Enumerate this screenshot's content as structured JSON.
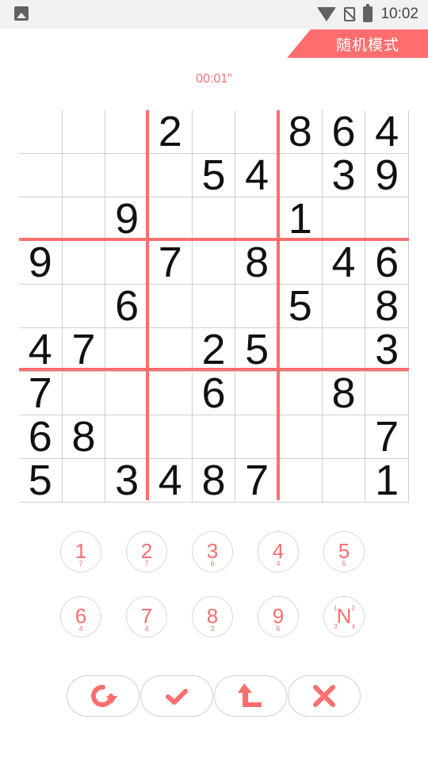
{
  "status_bar": {
    "time": "10:02",
    "icons": [
      "image-icon",
      "wifi-icon",
      "no-sim-icon",
      "battery-charging-icon"
    ]
  },
  "mode_label": "随机模式",
  "timer": "00:01\"",
  "accent_color": "#ff6e6e",
  "board": [
    [
      "",
      "",
      "",
      "2",
      "",
      "",
      "8",
      "6",
      "4"
    ],
    [
      "",
      "",
      "",
      "",
      "5",
      "4",
      "",
      "3",
      "9"
    ],
    [
      "",
      "",
      "9",
      "",
      "",
      "",
      "1",
      "",
      ""
    ],
    [
      "9",
      "",
      "",
      "7",
      "",
      "8",
      "",
      "4",
      "6"
    ],
    [
      "",
      "",
      "6",
      "",
      "",
      "",
      "5",
      "",
      "8"
    ],
    [
      "4",
      "7",
      "",
      "",
      "2",
      "5",
      "",
      "",
      "3"
    ],
    [
      "7",
      "",
      "",
      "",
      "6",
      "",
      "",
      "8",
      ""
    ],
    [
      "6",
      "8",
      "",
      "",
      "",
      "",
      "",
      "",
      "7"
    ],
    [
      "5",
      "",
      "3",
      "4",
      "8",
      "7",
      "",
      "",
      "1"
    ]
  ],
  "number_pad": [
    {
      "label": "1",
      "remaining": "7"
    },
    {
      "label": "2",
      "remaining": "7"
    },
    {
      "label": "3",
      "remaining": "6"
    },
    {
      "label": "4",
      "remaining": "4"
    },
    {
      "label": "5",
      "remaining": "5"
    },
    {
      "label": "6",
      "remaining": "4"
    },
    {
      "label": "7",
      "remaining": "4"
    },
    {
      "label": "8",
      "remaining": "3"
    },
    {
      "label": "9",
      "remaining": "6"
    }
  ],
  "note_button": {
    "label": "N",
    "corners": [
      "1",
      "2",
      "3",
      "4"
    ]
  },
  "actions": [
    "undo-icon",
    "check-icon",
    "erase-icon",
    "close-icon"
  ]
}
